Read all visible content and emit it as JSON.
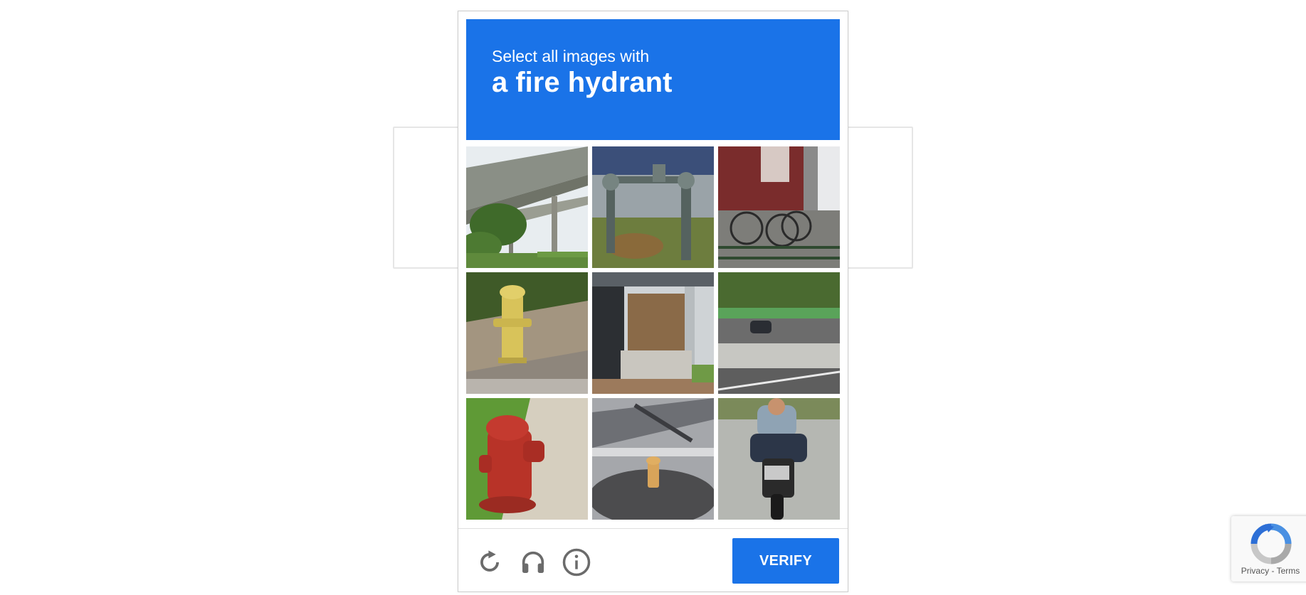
{
  "prompt": {
    "line1": "Select all images with",
    "line2": "a fire hydrant"
  },
  "tiles": [
    {
      "id": 1,
      "subject": "highway overpass"
    },
    {
      "id": 2,
      "subject": "standpipe"
    },
    {
      "id": 3,
      "subject": "bicycles"
    },
    {
      "id": 4,
      "subject": "yellow fire hydrant"
    },
    {
      "id": 5,
      "subject": "building entrance"
    },
    {
      "id": 6,
      "subject": "road with car"
    },
    {
      "id": 7,
      "subject": "red fire hydrant"
    },
    {
      "id": 8,
      "subject": "small yellow fire hydrant"
    },
    {
      "id": 9,
      "subject": "motorcycle rider"
    }
  ],
  "footer": {
    "reload_icon": "reload-icon",
    "audio_icon": "headphones-icon",
    "info_icon": "info-icon",
    "verify_label": "VERIFY"
  },
  "badge": {
    "privacy": "Privacy",
    "separator": "-",
    "terms": "Terms"
  },
  "colors": {
    "accent": "#1a73e8",
    "icon_gray": "#6b6b6b"
  }
}
